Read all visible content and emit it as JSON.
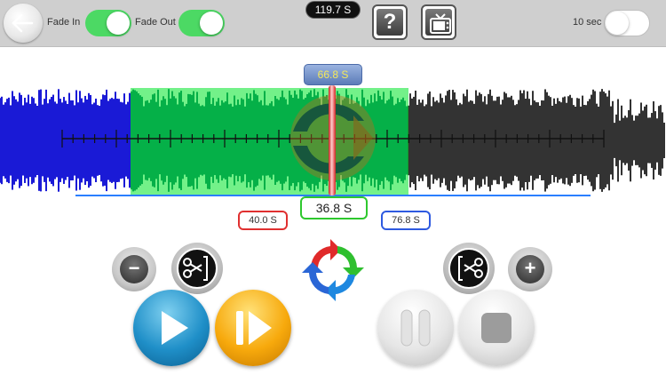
{
  "topbar": {
    "fade_in_label": "Fade In",
    "fade_in_on": true,
    "fade_out_label": "Fade Out",
    "fade_out_on": true,
    "total_duration": "119.7 S",
    "help_glyph": "?",
    "loop_label": "10 sec",
    "loop_on": false,
    "icons": {
      "back": "back-arrow-icon",
      "help": "question-mark-icon",
      "tv": "tv-icon"
    }
  },
  "waveform": {
    "playhead_time": "66.8 S",
    "selection_duration": "36.8 S",
    "selection_start": "40.0 S",
    "selection_end": "76.8 S",
    "colors": {
      "before_selection": "#1a1ad6",
      "selection_wave": "#0d6f6f",
      "after_selection": "#333333",
      "selection_highlight": "#22e03a",
      "playhead": "#d42222"
    }
  },
  "controls": {
    "zoom_out_glyph": "−",
    "zoom_in_glyph": "+",
    "icons": {
      "zoom_out": "minus-icon",
      "trim_left": "scissors-icon",
      "reset": "cycle-arrows-icon",
      "trim_right": "scissors-icon",
      "zoom_in": "plus-icon",
      "play": "play-icon",
      "play_selection": "play-selection-icon",
      "pause": "pause-icon",
      "stop": "stop-icon"
    }
  }
}
